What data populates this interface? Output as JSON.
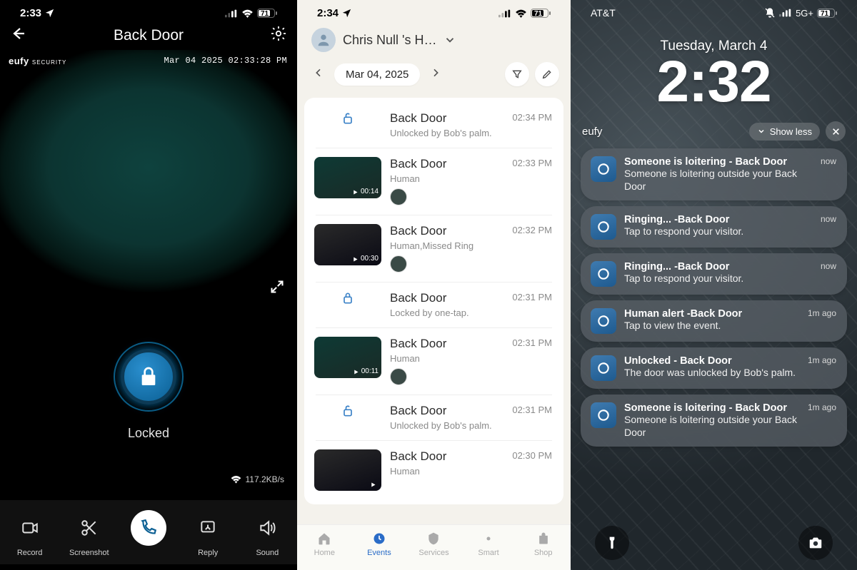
{
  "pane1": {
    "status_time": "2:33",
    "battery": "71",
    "title": "Back Door",
    "watermark": "eufy",
    "watermark_small": "SECURITY",
    "overlay_timestamp": "Mar 04 2025  02:33:28 PM",
    "lock_state": "Locked",
    "speed": "117.2KB/s",
    "toolbar": [
      {
        "label": "Record"
      },
      {
        "label": "Screenshot"
      },
      {
        "label": ""
      },
      {
        "label": "Reply"
      },
      {
        "label": "Sound"
      }
    ]
  },
  "pane2": {
    "status_time": "2:34",
    "battery": "71",
    "account_name": "Chris Null 's H…",
    "date": "Mar 04, 2025",
    "events": [
      {
        "icon": "unlock",
        "title": "Back Door",
        "sub": "Unlocked by Bob's palm.",
        "time": "02:34 PM"
      },
      {
        "icon": "thumb",
        "thumb": "green",
        "dur": "00:14",
        "title": "Back Door",
        "sub": "Human",
        "face": true,
        "time": "02:33 PM"
      },
      {
        "icon": "thumb",
        "thumb": "dark",
        "dur": "00:30",
        "title": "Back Door",
        "sub": "Human,Missed Ring",
        "face": true,
        "time": "02:32 PM"
      },
      {
        "icon": "lock",
        "title": "Back Door",
        "sub": "Locked by one-tap.",
        "time": "02:31 PM"
      },
      {
        "icon": "thumb",
        "thumb": "green",
        "dur": "00:11",
        "title": "Back Door",
        "sub": "Human",
        "face": true,
        "time": "02:31 PM"
      },
      {
        "icon": "unlock",
        "title": "Back Door",
        "sub": "Unlocked by Bob's palm.",
        "time": "02:31 PM"
      },
      {
        "icon": "thumb",
        "thumb": "dark",
        "dur": "",
        "title": "Back Door",
        "sub": "Human",
        "time": "02:30 PM"
      }
    ],
    "nav": [
      {
        "label": "Home"
      },
      {
        "label": "Events"
      },
      {
        "label": "Services"
      },
      {
        "label": "Smart"
      },
      {
        "label": "Shop"
      }
    ],
    "nav_active": 1
  },
  "pane3": {
    "carrier": "AT&T",
    "net": "5G+",
    "battery": "71",
    "date": "Tuesday, March 4",
    "time": "2:32",
    "app_label": "eufy",
    "show_less": "Show less",
    "notifs": [
      {
        "title": "Someone is loitering - Back Door",
        "body": "Someone is loitering outside your Back Door",
        "time": "now"
      },
      {
        "title": "Ringing... -Back Door",
        "body": "Tap to respond your visitor.",
        "time": "now"
      },
      {
        "title": "Ringing... -Back Door",
        "body": "Tap to respond your visitor.",
        "time": "now"
      },
      {
        "title": "Human alert -Back Door",
        "body": "Tap to view the event.",
        "time": "1m ago"
      },
      {
        "title": "Unlocked - Back Door",
        "body": "The door was unlocked by Bob's palm.",
        "time": "1m ago"
      },
      {
        "title": "Someone is loitering - Back Door",
        "body": "Someone is loitering outside your Back Door",
        "time": "1m ago"
      }
    ],
    "faded_body": "Tap to view the event."
  }
}
